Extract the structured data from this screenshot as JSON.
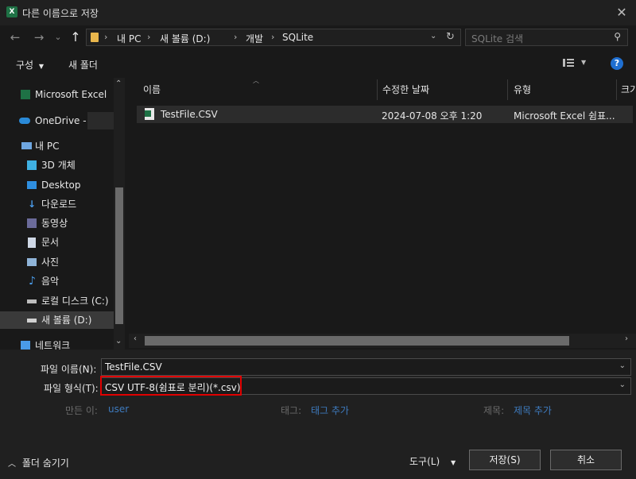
{
  "window": {
    "title": "다른 이름으로 저장",
    "app_icon": "excel-icon",
    "close": "✕"
  },
  "nav": {
    "breadcrumbs": [
      "내 PC",
      "새 볼륨 (D:)",
      "개발",
      "SQLite"
    ],
    "search_placeholder": "SQLite 검색"
  },
  "toolbar": {
    "organize_label": "구성",
    "new_folder_label": "새 폴더",
    "help": "?"
  },
  "sidebar": {
    "items": [
      {
        "label": "Microsoft Excel",
        "icon": "excel-icon"
      },
      {
        "label": "OneDrive -",
        "icon": "cloud-icon"
      },
      {
        "label": "내 PC",
        "icon": "pc-icon"
      },
      {
        "label": "3D 개체",
        "icon": "cube-icon"
      },
      {
        "label": "Desktop",
        "icon": "desktop-icon"
      },
      {
        "label": "다운로드",
        "icon": "download-icon"
      },
      {
        "label": "동영상",
        "icon": "video-icon"
      },
      {
        "label": "문서",
        "icon": "document-icon"
      },
      {
        "label": "사진",
        "icon": "picture-icon"
      },
      {
        "label": "음악",
        "icon": "music-icon"
      },
      {
        "label": "로컬 디스크 (C:)",
        "icon": "drive-icon"
      },
      {
        "label": "새 볼륨 (D:)",
        "icon": "drive-icon"
      },
      {
        "label": "네트워크",
        "icon": "network-icon"
      }
    ],
    "selected_index": 11
  },
  "files": {
    "columns": [
      "이름",
      "수정한 날짜",
      "유형",
      "크기"
    ],
    "rows": [
      {
        "name": "TestFile.CSV",
        "modified": "2024-07-08 오후 1:20",
        "type": "Microsoft Excel 쉼표...",
        "icon": "csv-file-icon"
      }
    ]
  },
  "form": {
    "filename_label": "파일 이름(N):",
    "filename_value": "TestFile.CSV",
    "filetype_label": "파일 형식(T):",
    "filetype_value": "CSV UTF-8(쉼표로 분리)(*.csv)",
    "author_label": "만든 이:",
    "author_value": "user",
    "tags_label": "태그:",
    "tags_value": "태그 추가",
    "title_label": "제목:",
    "title_value": "제목 추가"
  },
  "footer": {
    "hide_folders_label": "폴더 숨기기",
    "tools_label": "도구(L)",
    "save_label": "저장(S)",
    "cancel_label": "취소"
  },
  "colors": {
    "highlight_box": "#e00000",
    "link": "#3e7bbf",
    "accent": "#1e7145"
  }
}
